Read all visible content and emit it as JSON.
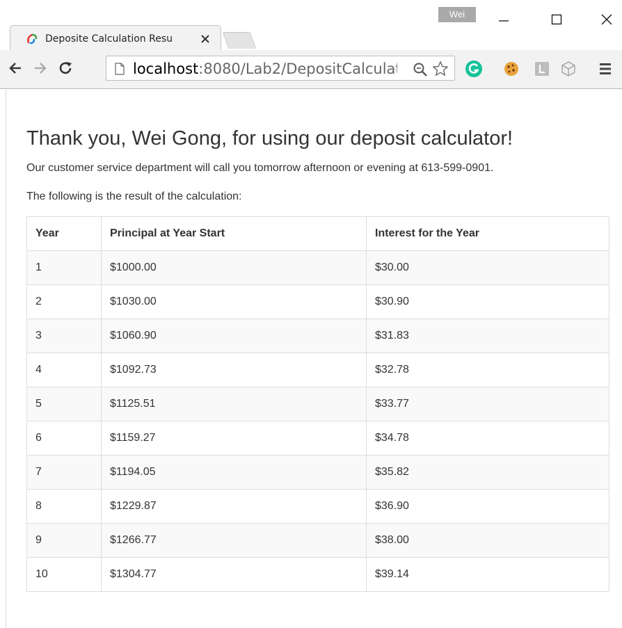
{
  "browser": {
    "profile_name": "Wei",
    "tab_title": "Deposite Calculation Resu",
    "url_host": "localhost",
    "url_path": ":8080/Lab2/DepositCalculat"
  },
  "page": {
    "heading": "Thank you, Wei Gong, for using our deposit calculator!",
    "service_message": "Our customer service department will call you tomorrow afternoon or evening at 613-599-0901.",
    "result_intro": "The following is the result of the calculation:",
    "table": {
      "headers": [
        "Year",
        "Principal at Year Start",
        "Interest for the Year"
      ],
      "rows": [
        [
          "1",
          "$1000.00",
          "$30.00"
        ],
        [
          "2",
          "$1030.00",
          "$30.90"
        ],
        [
          "3",
          "$1060.90",
          "$31.83"
        ],
        [
          "4",
          "$1092.73",
          "$32.78"
        ],
        [
          "5",
          "$1125.51",
          "$33.77"
        ],
        [
          "6",
          "$1159.27",
          "$34.78"
        ],
        [
          "7",
          "$1194.05",
          "$35.82"
        ],
        [
          "8",
          "$1229.87",
          "$36.90"
        ],
        [
          "9",
          "$1266.77",
          "$38.00"
        ],
        [
          "10",
          "$1304.77",
          "$39.14"
        ]
      ]
    }
  },
  "colors": {
    "grammarly_green": "#15c39a",
    "row_stripe": "#f9f9f9",
    "border": "#dddddd"
  }
}
